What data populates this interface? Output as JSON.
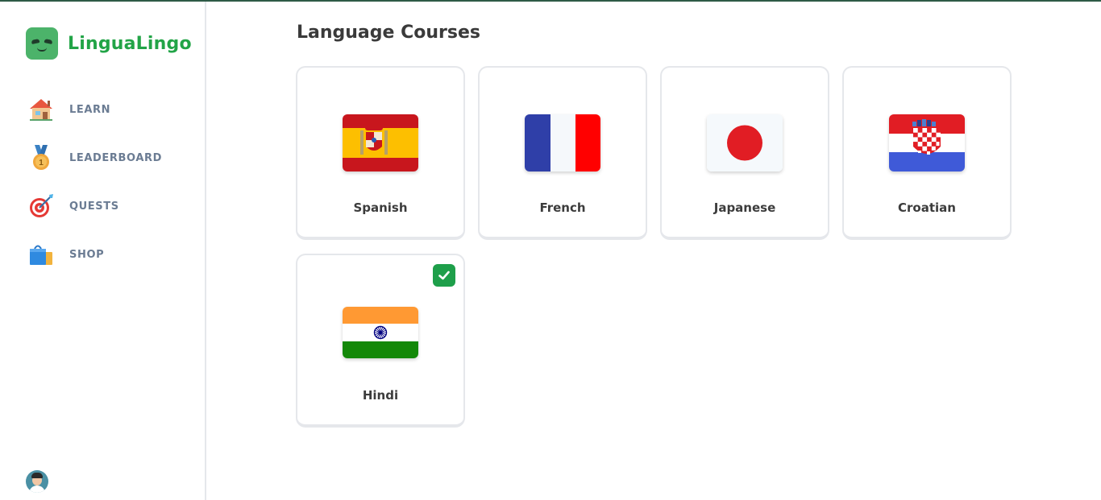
{
  "app": {
    "name": "LinguaLingo",
    "accent": "#22a447"
  },
  "sidebar": {
    "items": [
      {
        "label": "LEARN",
        "icon": "house-icon"
      },
      {
        "label": "LEADERBOARD",
        "icon": "medal-icon"
      },
      {
        "label": "QUESTS",
        "icon": "target-icon"
      },
      {
        "label": "SHOP",
        "icon": "shopping-bag-icon"
      }
    ],
    "avatar_icon": "user-avatar"
  },
  "main": {
    "title": "Language Courses",
    "courses": [
      {
        "label": "Spanish",
        "flag": "spain-flag",
        "active": false
      },
      {
        "label": "French",
        "flag": "france-flag",
        "active": false
      },
      {
        "label": "Japanese",
        "flag": "japan-flag",
        "active": false
      },
      {
        "label": "Croatian",
        "flag": "croatia-flag",
        "active": false
      },
      {
        "label": "Hindi",
        "flag": "india-flag",
        "active": true
      }
    ],
    "active_badge_icon": "checkmark-icon",
    "active_color": "#1e9f4a"
  }
}
